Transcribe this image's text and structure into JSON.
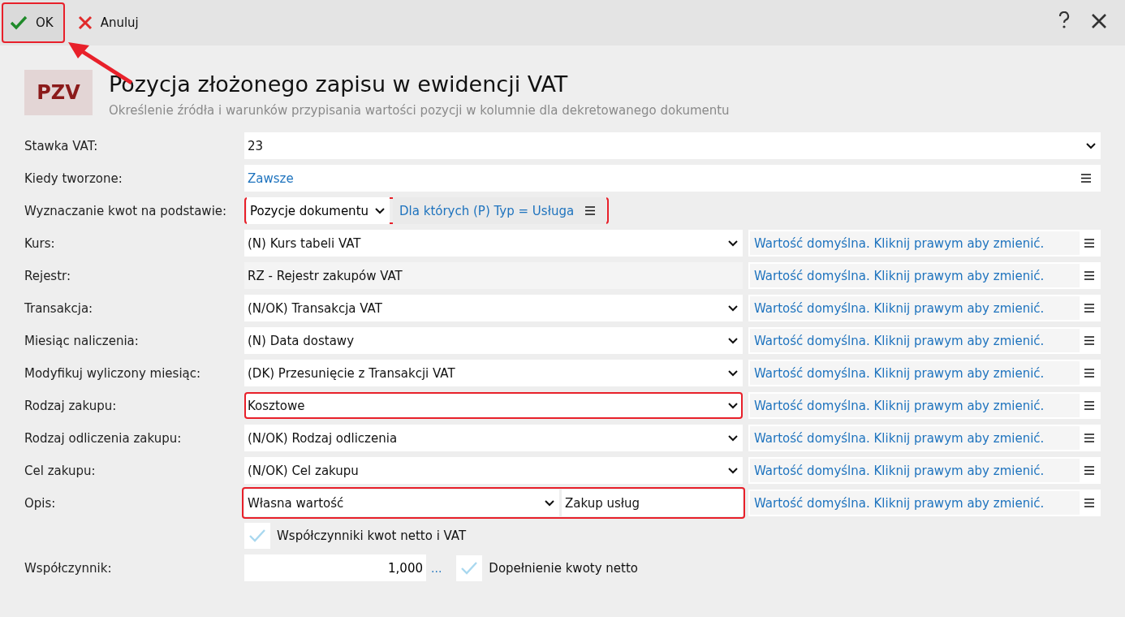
{
  "toolbar": {
    "ok": {
      "label": "OK",
      "highlighted": true
    },
    "cancel": {
      "label": "Anuluj"
    }
  },
  "header": {
    "badge": "PZV",
    "title": "Pozycja złożonego zapisu w ewidencji VAT",
    "subtitle": "Określenie źródła i warunków przypisania wartości pozycji w kolumnie dla dekretowanego dokumentu"
  },
  "rows": [
    {
      "kind": "select",
      "label": "Stawka VAT:",
      "value": "23",
      "highlighted": false
    },
    {
      "kind": "link",
      "label": "Kiedy tworzone:",
      "value": "Zawsze",
      "highlighted": false
    },
    {
      "kind": "split",
      "label": "Wyznaczanie kwot na podstawie:",
      "value": "Pozycje dokumentu",
      "link": "Dla których (P) Typ = Usługa",
      "highlighted": true
    },
    {
      "kind": "select-default",
      "label": "Kurs:",
      "value": "(N) Kurs tabeli VAT",
      "default": "Wartość domyślna. Kliknij prawym aby zmienić.",
      "highlighted": false
    },
    {
      "kind": "readonly-default",
      "label": "Rejestr:",
      "value": "RZ - Rejestr zakupów VAT",
      "default": "Wartość domyślna. Kliknij prawym aby zmienić.",
      "highlighted": false
    },
    {
      "kind": "select-default",
      "label": "Transakcja:",
      "value": "(N/OK) Transakcja VAT",
      "default": "Wartość domyślna. Kliknij prawym aby zmienić.",
      "highlighted": false
    },
    {
      "kind": "select-default",
      "label": "Miesiąc naliczenia:",
      "value": "(N) Data dostawy",
      "default": "Wartość domyślna. Kliknij prawym aby zmienić.",
      "highlighted": false
    },
    {
      "kind": "select-default",
      "label": "Modyfikuj wyliczony miesiąc:",
      "value": "(DK) Przesunięcie z Transakcji VAT",
      "default": "Wartość domyślna. Kliknij prawym aby zmienić.",
      "highlighted": false
    },
    {
      "kind": "select-default",
      "label": "Rodzaj zakupu:",
      "value": "Kosztowe",
      "default": "Wartość domyślna. Kliknij prawym aby zmienić.",
      "highlighted": true
    },
    {
      "kind": "select-default",
      "label": "Rodzaj odliczenia zakupu:",
      "value": "(N/OK) Rodzaj odliczenia",
      "default": "Wartość domyślna. Kliknij prawym aby zmienić.",
      "highlighted": false
    },
    {
      "kind": "select-default",
      "label": "Cel zakupu:",
      "value": "(N/OK) Cel zakupu",
      "default": "Wartość domyślna. Kliknij prawym aby zmienić.",
      "highlighted": false
    },
    {
      "kind": "select-text-default",
      "label": "Opis:",
      "value": "Własna wartość",
      "text": "Zakup usług",
      "default": "Wartość domyślna. Kliknij prawym aby zmienić.",
      "highlighted": true
    }
  ],
  "coefficients_checkbox": {
    "label": "Współczynniki kwot netto i VAT",
    "checked": true
  },
  "coefficient": {
    "label": "Współczynnik:",
    "value": "1,000",
    "more": "...",
    "checkbox": {
      "label": "Dopełnienie kwoty netto",
      "checked": true
    }
  }
}
